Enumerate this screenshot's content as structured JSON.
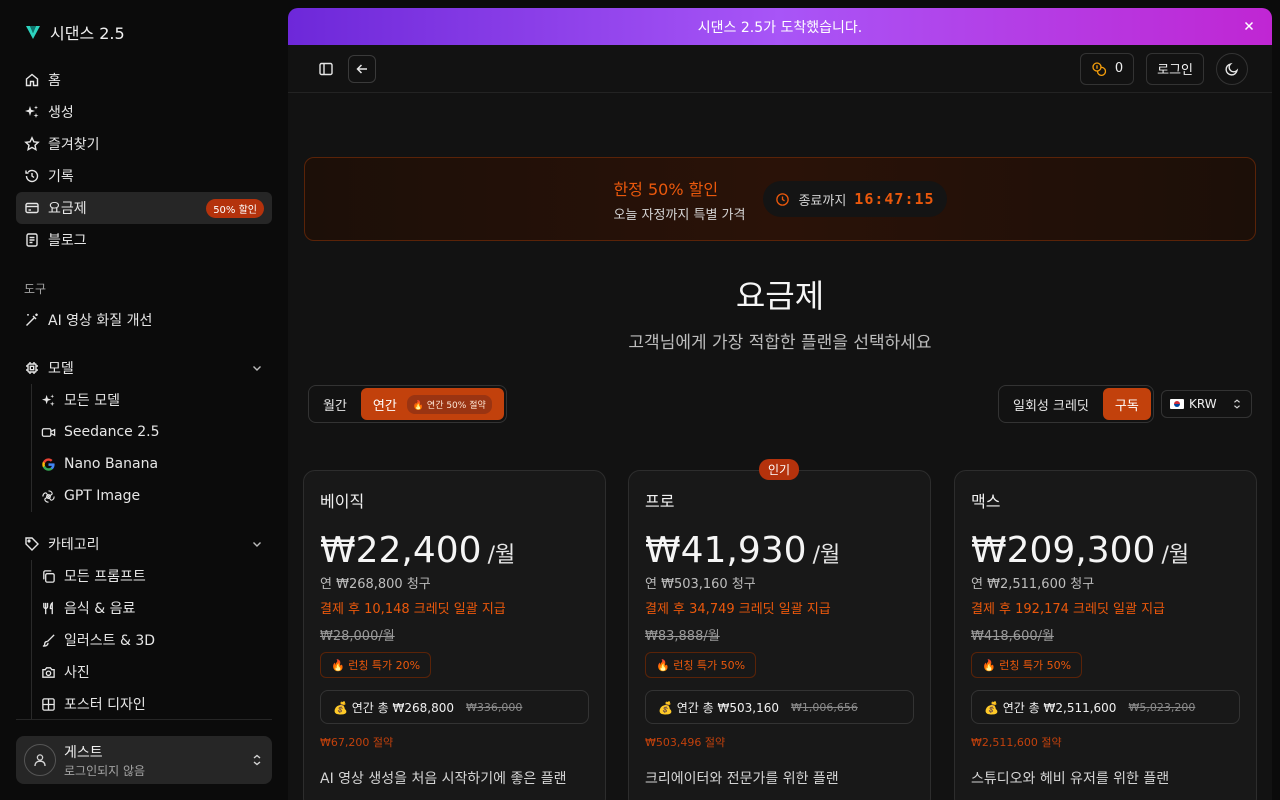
{
  "brand": {
    "name": "시댄스 2.5"
  },
  "sidebar": {
    "nav": [
      {
        "label": "홈",
        "icon": "home-icon"
      },
      {
        "label": "생성",
        "icon": "sparkles-icon"
      },
      {
        "label": "즐겨찾기",
        "icon": "star-icon"
      },
      {
        "label": "기록",
        "icon": "history-icon"
      },
      {
        "label": "요금제",
        "icon": "card-icon",
        "badge": "50% 할인",
        "active": true
      },
      {
        "label": "블로그",
        "icon": "doc-icon"
      }
    ],
    "tools_label": "도구",
    "tools": [
      {
        "label": "AI 영상 화질 개선",
        "icon": "wand-icon"
      }
    ],
    "models_label": "모델",
    "models": [
      {
        "label": "모든 모델",
        "icon": "sparkles-icon"
      },
      {
        "label": "Seedance 2.5",
        "icon": "video-icon"
      },
      {
        "label": "Nano Banana",
        "icon": "google-icon"
      },
      {
        "label": "GPT Image",
        "icon": "openai-icon"
      }
    ],
    "categories_label": "카테고리",
    "categories": [
      {
        "label": "모든 프롬프트",
        "icon": "copy-icon"
      },
      {
        "label": "음식 & 음료",
        "icon": "utensils-icon"
      },
      {
        "label": "일러스트 & 3D",
        "icon": "brush-icon"
      },
      {
        "label": "사진",
        "icon": "camera-icon"
      },
      {
        "label": "포스터 디자인",
        "icon": "grid-icon"
      }
    ],
    "user": {
      "name": "게스트",
      "status": "로그인되지 않음"
    }
  },
  "banner": {
    "text": "시댄스 2.5가 도착했습니다."
  },
  "topbar": {
    "credits": "0",
    "login": "로그인"
  },
  "promo": {
    "title": "한정 50% 할인",
    "subtitle": "오늘 자정까지 특별 가격",
    "ends_label": "종료까지",
    "countdown": "16:47:15"
  },
  "page": {
    "title": "요금제",
    "subtitle": "고객님에게 가장 적합한 플랜을 선택하세요"
  },
  "billing": {
    "monthly": "월간",
    "yearly": "연간",
    "yearly_tag": "🔥 연간 50% 절약"
  },
  "purchase_type": {
    "onetime": "일회성 크레딧",
    "subscription": "구독"
  },
  "currency": {
    "code": "KRW"
  },
  "popular_label": "인기",
  "plans": [
    {
      "name": "베이직",
      "price": "₩22,400",
      "per": "/월",
      "yearly": "연 ₩268,800 청구",
      "credits": "결제 후 10,148 크레딧 일괄 지급",
      "original": "₩28,000/월",
      "launch": "🔥 런칭 특가 20%",
      "total": "💰 연간 총 ₩268,800",
      "total_old": "₩336,000",
      "save": "₩67,200 절약",
      "desc": "AI 영상 생성을 처음 시작하기에 좋은 플랜"
    },
    {
      "name": "프로",
      "price": "₩41,930",
      "per": "/월",
      "yearly": "연 ₩503,160 청구",
      "credits": "결제 후 34,749 크레딧 일괄 지급",
      "original": "₩83,888/월",
      "launch": "🔥 런칭 특가 50%",
      "total": "💰 연간 총 ₩503,160",
      "total_old": "₩1,006,656",
      "save": "₩503,496 절약",
      "desc": "크리에이터와 전문가를 위한 플랜"
    },
    {
      "name": "맥스",
      "price": "₩209,300",
      "per": "/월",
      "yearly": "연 ₩2,511,600 청구",
      "credits": "결제 후 192,174 크레딧 일괄 지급",
      "original": "₩418,600/월",
      "launch": "🔥 런칭 특가 50%",
      "total": "💰 연간 총 ₩2,511,600",
      "total_old": "₩5,023,200",
      "save": "₩2,511,600 절약",
      "desc": "스튜디오와 헤비 유저를 위한 플랜"
    }
  ],
  "colors": {
    "accent": "#c2410c",
    "accent_text": "#ea580c",
    "banner_start": "#6d28d9",
    "banner_end": "#c026d3"
  }
}
